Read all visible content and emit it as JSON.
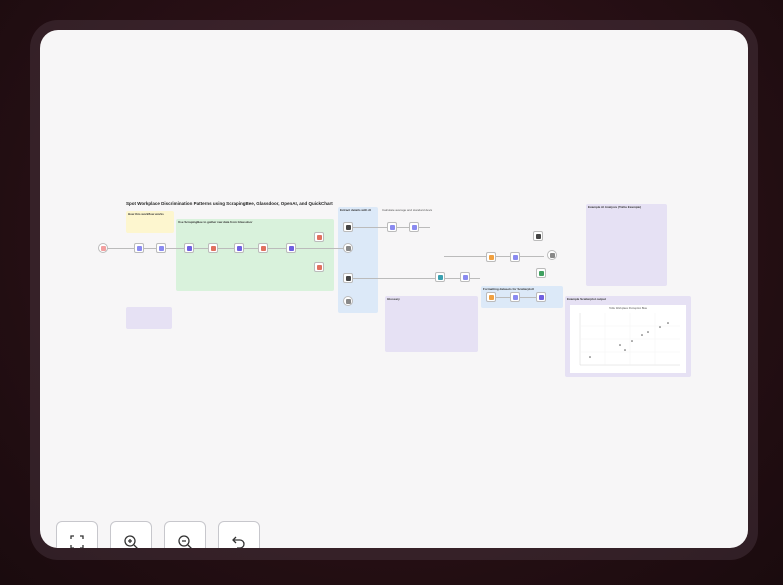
{
  "workflow": {
    "title": "Spot Workplace Discrimination Patterns using ScrapingBee, Glassdoor, OpenAI, and QuickChart"
  },
  "notes": {
    "how_it_works": "How this workflow works",
    "scrape_section": "Use ScrapingBee to gather raw data from Glassdoor",
    "extract_section": "Extract details with AI",
    "analysis_note": "Calculate average and standard deviation from review rating distribution",
    "formatting_section": "Formatting datasets for ScatterplotI",
    "glossary_title": "Glossary",
    "example_analysis": "Example AI Analysis (Toiltu Example)",
    "example_output": "Example Scatterplot output"
  },
  "chart_data": {
    "type": "scatter",
    "title": "Toiltu Workplace Perception Bias"
  },
  "controls": {
    "fit_view": "fit-view",
    "zoom_in": "zoom-in",
    "zoom_out": "zoom-out",
    "reset": "reset-zoom"
  },
  "colors": {
    "background": "#2a1016",
    "canvas": "#f7f6f7",
    "sticky_yellow": "#fdf6cf",
    "sticky_green": "#d9f2dc",
    "sticky_blue": "#dce9f8",
    "sticky_purple": "#e6e1f4"
  }
}
